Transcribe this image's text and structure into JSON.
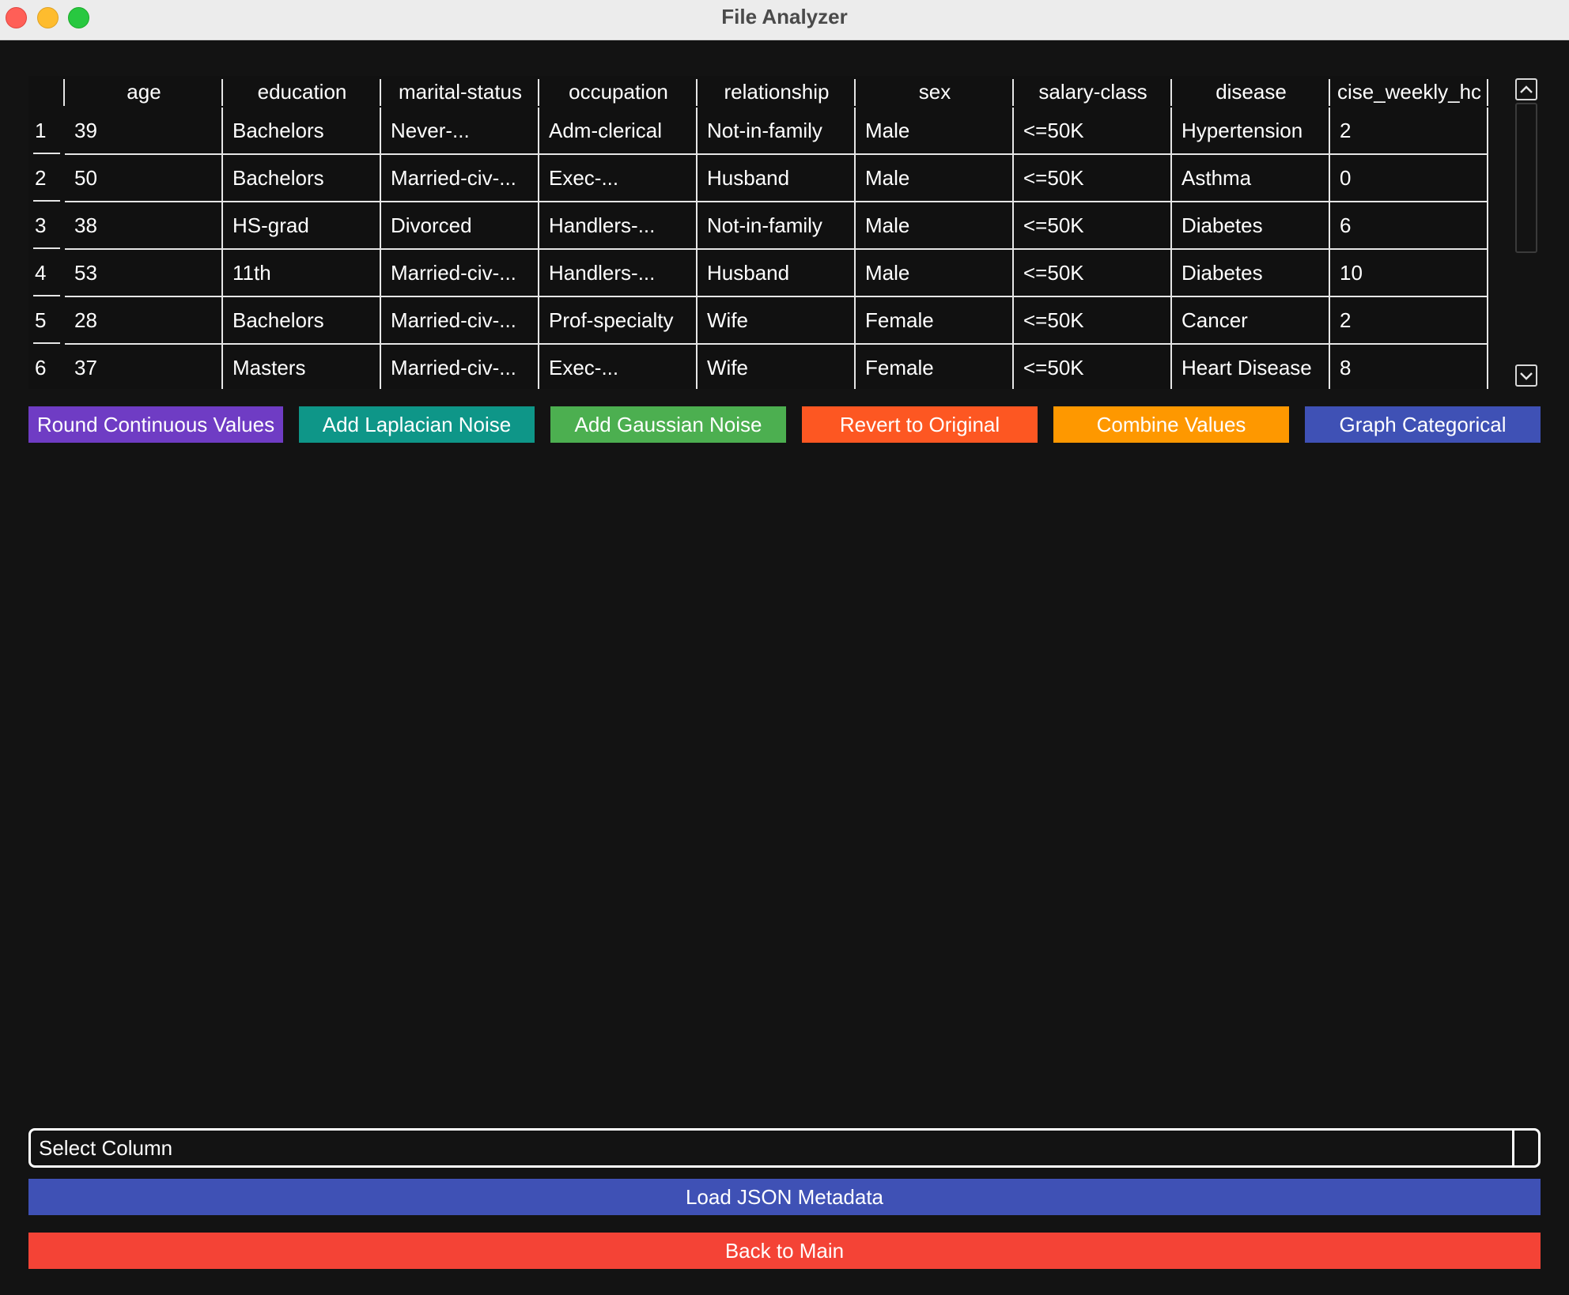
{
  "window": {
    "title": "File Analyzer"
  },
  "table": {
    "headers": [
      "age",
      "education",
      "marital-status",
      "occupation",
      "relationship",
      "sex",
      "salary-class",
      "disease",
      "cise_weekly_hc"
    ],
    "rows": [
      {
        "num": "1",
        "cells": [
          "39",
          "Bachelors",
          "Never-...",
          "Adm-clerical",
          "Not-in-family",
          "Male",
          "<=50K",
          "Hypertension",
          "2"
        ]
      },
      {
        "num": "2",
        "cells": [
          "50",
          "Bachelors",
          "Married-civ-...",
          "Exec-...",
          "Husband",
          "Male",
          "<=50K",
          "Asthma",
          "0"
        ]
      },
      {
        "num": "3",
        "cells": [
          "38",
          "HS-grad",
          "Divorced",
          "Handlers-...",
          "Not-in-family",
          "Male",
          "<=50K",
          "Diabetes",
          "6"
        ]
      },
      {
        "num": "4",
        "cells": [
          "53",
          "11th",
          "Married-civ-...",
          "Handlers-...",
          "Husband",
          "Male",
          "<=50K",
          "Diabetes",
          "10"
        ]
      },
      {
        "num": "5",
        "cells": [
          "28",
          "Bachelors",
          "Married-civ-...",
          "Prof-specialty",
          "Wife",
          "Female",
          "<=50K",
          "Cancer",
          "2"
        ]
      },
      {
        "num": "6",
        "cells": [
          "37",
          "Masters",
          "Married-civ-...",
          "Exec-...",
          "Wife",
          "Female",
          "<=50K",
          "Heart Disease",
          "8"
        ]
      }
    ]
  },
  "actions": [
    {
      "name": "round-continuous-values-button",
      "label": "Round Continuous Values",
      "color": "#6f3cc4"
    },
    {
      "name": "add-laplacian-noise-button",
      "label": "Add Laplacian Noise",
      "color": "#0e9688"
    },
    {
      "name": "add-gaussian-noise-button",
      "label": "Add Gaussian Noise",
      "color": "#4caf50"
    },
    {
      "name": "revert-to-original-button",
      "label": "Revert to Original",
      "color": "#fd5722"
    },
    {
      "name": "combine-values-button",
      "label": "Combine Values",
      "color": "#fe9800"
    },
    {
      "name": "graph-categorical-button",
      "label": "Graph Categorical",
      "color": "#3f51b5"
    }
  ],
  "select_column": {
    "label": "Select Column"
  },
  "load_json_button": {
    "label": "Load JSON Metadata",
    "color": "#3f51b5"
  },
  "back_button": {
    "label": "Back to Main",
    "color": "#f44336"
  },
  "icons": {
    "scroll_up": "chevron-up-icon",
    "scroll_down": "chevron-down-icon"
  }
}
